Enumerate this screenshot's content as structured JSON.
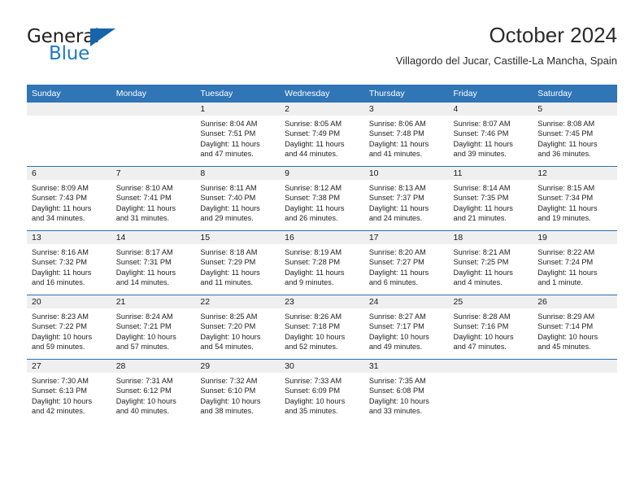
{
  "logo": {
    "line1": "General",
    "line2": "Blue",
    "triangle_icon": "triangle-icon",
    "color_dark": "#231f20",
    "color_blue": "#1f7ac4",
    "color_triangle": "#1664ab"
  },
  "header": {
    "month_title": "October 2024",
    "location": "Villagordo del Jucar, Castille-La Mancha, Spain"
  },
  "theme": {
    "header_band": "#3075b6",
    "row_divider": "#2f6fad",
    "daynum_band": "#efefef"
  },
  "calendar": {
    "weekday_headers": [
      "Sunday",
      "Monday",
      "Tuesday",
      "Wednesday",
      "Thursday",
      "Friday",
      "Saturday"
    ],
    "weeks": [
      [
        {
          "day": "",
          "sunrise": "",
          "sunset": "",
          "daylight1": "",
          "daylight2": ""
        },
        {
          "day": "",
          "sunrise": "",
          "sunset": "",
          "daylight1": "",
          "daylight2": ""
        },
        {
          "day": "1",
          "sunrise": "Sunrise: 8:04 AM",
          "sunset": "Sunset: 7:51 PM",
          "daylight1": "Daylight: 11 hours",
          "daylight2": "and 47 minutes."
        },
        {
          "day": "2",
          "sunrise": "Sunrise: 8:05 AM",
          "sunset": "Sunset: 7:49 PM",
          "daylight1": "Daylight: 11 hours",
          "daylight2": "and 44 minutes."
        },
        {
          "day": "3",
          "sunrise": "Sunrise: 8:06 AM",
          "sunset": "Sunset: 7:48 PM",
          "daylight1": "Daylight: 11 hours",
          "daylight2": "and 41 minutes."
        },
        {
          "day": "4",
          "sunrise": "Sunrise: 8:07 AM",
          "sunset": "Sunset: 7:46 PM",
          "daylight1": "Daylight: 11 hours",
          "daylight2": "and 39 minutes."
        },
        {
          "day": "5",
          "sunrise": "Sunrise: 8:08 AM",
          "sunset": "Sunset: 7:45 PM",
          "daylight1": "Daylight: 11 hours",
          "daylight2": "and 36 minutes."
        }
      ],
      [
        {
          "day": "6",
          "sunrise": "Sunrise: 8:09 AM",
          "sunset": "Sunset: 7:43 PM",
          "daylight1": "Daylight: 11 hours",
          "daylight2": "and 34 minutes."
        },
        {
          "day": "7",
          "sunrise": "Sunrise: 8:10 AM",
          "sunset": "Sunset: 7:41 PM",
          "daylight1": "Daylight: 11 hours",
          "daylight2": "and 31 minutes."
        },
        {
          "day": "8",
          "sunrise": "Sunrise: 8:11 AM",
          "sunset": "Sunset: 7:40 PM",
          "daylight1": "Daylight: 11 hours",
          "daylight2": "and 29 minutes."
        },
        {
          "day": "9",
          "sunrise": "Sunrise: 8:12 AM",
          "sunset": "Sunset: 7:38 PM",
          "daylight1": "Daylight: 11 hours",
          "daylight2": "and 26 minutes."
        },
        {
          "day": "10",
          "sunrise": "Sunrise: 8:13 AM",
          "sunset": "Sunset: 7:37 PM",
          "daylight1": "Daylight: 11 hours",
          "daylight2": "and 24 minutes."
        },
        {
          "day": "11",
          "sunrise": "Sunrise: 8:14 AM",
          "sunset": "Sunset: 7:35 PM",
          "daylight1": "Daylight: 11 hours",
          "daylight2": "and 21 minutes."
        },
        {
          "day": "12",
          "sunrise": "Sunrise: 8:15 AM",
          "sunset": "Sunset: 7:34 PM",
          "daylight1": "Daylight: 11 hours",
          "daylight2": "and 19 minutes."
        }
      ],
      [
        {
          "day": "13",
          "sunrise": "Sunrise: 8:16 AM",
          "sunset": "Sunset: 7:32 PM",
          "daylight1": "Daylight: 11 hours",
          "daylight2": "and 16 minutes."
        },
        {
          "day": "14",
          "sunrise": "Sunrise: 8:17 AM",
          "sunset": "Sunset: 7:31 PM",
          "daylight1": "Daylight: 11 hours",
          "daylight2": "and 14 minutes."
        },
        {
          "day": "15",
          "sunrise": "Sunrise: 8:18 AM",
          "sunset": "Sunset: 7:29 PM",
          "daylight1": "Daylight: 11 hours",
          "daylight2": "and 11 minutes."
        },
        {
          "day": "16",
          "sunrise": "Sunrise: 8:19 AM",
          "sunset": "Sunset: 7:28 PM",
          "daylight1": "Daylight: 11 hours",
          "daylight2": "and 9 minutes."
        },
        {
          "day": "17",
          "sunrise": "Sunrise: 8:20 AM",
          "sunset": "Sunset: 7:27 PM",
          "daylight1": "Daylight: 11 hours",
          "daylight2": "and 6 minutes."
        },
        {
          "day": "18",
          "sunrise": "Sunrise: 8:21 AM",
          "sunset": "Sunset: 7:25 PM",
          "daylight1": "Daylight: 11 hours",
          "daylight2": "and 4 minutes."
        },
        {
          "day": "19",
          "sunrise": "Sunrise: 8:22 AM",
          "sunset": "Sunset: 7:24 PM",
          "daylight1": "Daylight: 11 hours",
          "daylight2": "and 1 minute."
        }
      ],
      [
        {
          "day": "20",
          "sunrise": "Sunrise: 8:23 AM",
          "sunset": "Sunset: 7:22 PM",
          "daylight1": "Daylight: 10 hours",
          "daylight2": "and 59 minutes."
        },
        {
          "day": "21",
          "sunrise": "Sunrise: 8:24 AM",
          "sunset": "Sunset: 7:21 PM",
          "daylight1": "Daylight: 10 hours",
          "daylight2": "and 57 minutes."
        },
        {
          "day": "22",
          "sunrise": "Sunrise: 8:25 AM",
          "sunset": "Sunset: 7:20 PM",
          "daylight1": "Daylight: 10 hours",
          "daylight2": "and 54 minutes."
        },
        {
          "day": "23",
          "sunrise": "Sunrise: 8:26 AM",
          "sunset": "Sunset: 7:18 PM",
          "daylight1": "Daylight: 10 hours",
          "daylight2": "and 52 minutes."
        },
        {
          "day": "24",
          "sunrise": "Sunrise: 8:27 AM",
          "sunset": "Sunset: 7:17 PM",
          "daylight1": "Daylight: 10 hours",
          "daylight2": "and 49 minutes."
        },
        {
          "day": "25",
          "sunrise": "Sunrise: 8:28 AM",
          "sunset": "Sunset: 7:16 PM",
          "daylight1": "Daylight: 10 hours",
          "daylight2": "and 47 minutes."
        },
        {
          "day": "26",
          "sunrise": "Sunrise: 8:29 AM",
          "sunset": "Sunset: 7:14 PM",
          "daylight1": "Daylight: 10 hours",
          "daylight2": "and 45 minutes."
        }
      ],
      [
        {
          "day": "27",
          "sunrise": "Sunrise: 7:30 AM",
          "sunset": "Sunset: 6:13 PM",
          "daylight1": "Daylight: 10 hours",
          "daylight2": "and 42 minutes."
        },
        {
          "day": "28",
          "sunrise": "Sunrise: 7:31 AM",
          "sunset": "Sunset: 6:12 PM",
          "daylight1": "Daylight: 10 hours",
          "daylight2": "and 40 minutes."
        },
        {
          "day": "29",
          "sunrise": "Sunrise: 7:32 AM",
          "sunset": "Sunset: 6:10 PM",
          "daylight1": "Daylight: 10 hours",
          "daylight2": "and 38 minutes."
        },
        {
          "day": "30",
          "sunrise": "Sunrise: 7:33 AM",
          "sunset": "Sunset: 6:09 PM",
          "daylight1": "Daylight: 10 hours",
          "daylight2": "and 35 minutes."
        },
        {
          "day": "31",
          "sunrise": "Sunrise: 7:35 AM",
          "sunset": "Sunset: 6:08 PM",
          "daylight1": "Daylight: 10 hours",
          "daylight2": "and 33 minutes."
        },
        {
          "day": "",
          "sunrise": "",
          "sunset": "",
          "daylight1": "",
          "daylight2": ""
        },
        {
          "day": "",
          "sunrise": "",
          "sunset": "",
          "daylight1": "",
          "daylight2": ""
        }
      ]
    ]
  }
}
